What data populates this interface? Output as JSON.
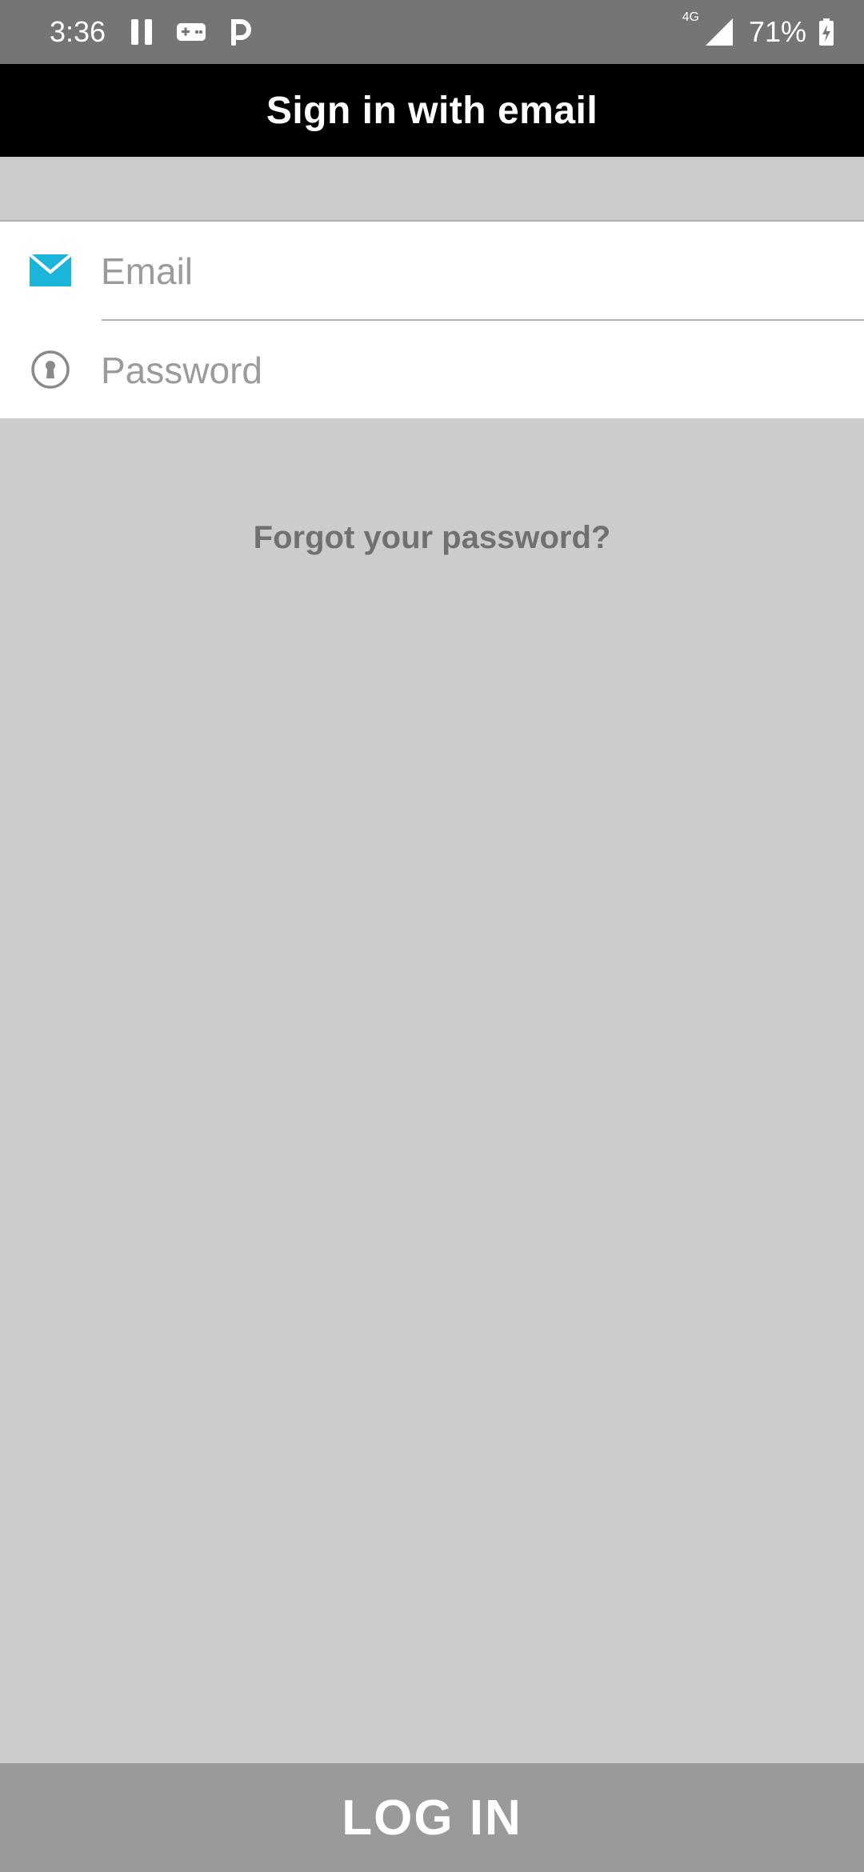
{
  "status_bar": {
    "time": "3:36",
    "network": "4G",
    "battery": "71%",
    "icons": [
      "pause-icon",
      "gamepad-icon",
      "parking-icon",
      "signal-icon",
      "battery-charging-icon"
    ]
  },
  "header": {
    "title": "Sign in with email"
  },
  "form": {
    "email": {
      "placeholder": "Email",
      "icon": "envelope-icon",
      "icon_color": "#1ab5d8"
    },
    "password": {
      "placeholder": "Password",
      "icon": "keyhole-icon"
    }
  },
  "links": {
    "forgot": "Forgot your password?"
  },
  "footer": {
    "login_label": "LOG IN"
  },
  "colors": {
    "status_bar": "#757575",
    "app_bar": "#000000",
    "background": "#cccccc",
    "button": "#9a9a9a",
    "accent": "#1ab5d8"
  }
}
